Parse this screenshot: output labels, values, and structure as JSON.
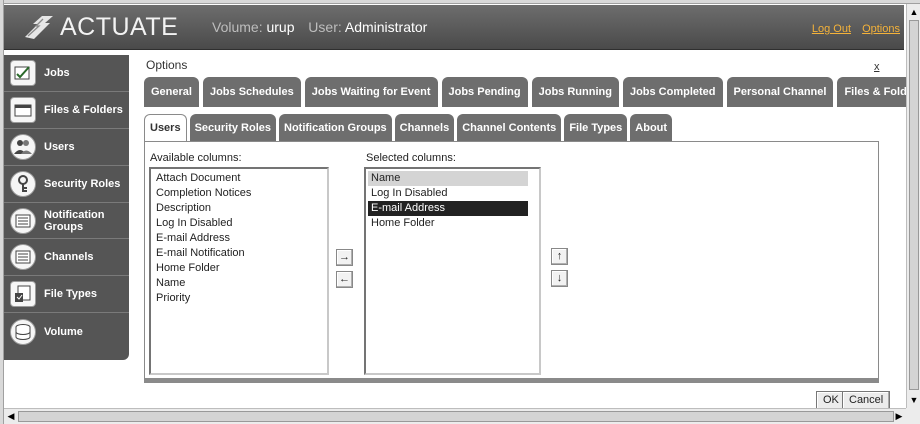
{
  "banner": {
    "logo_text": "ACTUATE",
    "volume_label": "Volume:",
    "volume_value": "urup",
    "user_label": "User:",
    "user_value": "Administrator",
    "logout": "Log Out",
    "options": "Options"
  },
  "nav": {
    "items": [
      {
        "label": "Jobs",
        "icon": "jobs-icon"
      },
      {
        "label": "Files & Folders",
        "icon": "folder-icon"
      },
      {
        "label": "Users",
        "icon": "users-icon"
      },
      {
        "label": "Security Roles",
        "icon": "key-icon"
      },
      {
        "label": "Notification Groups",
        "icon": "notification-icon"
      },
      {
        "label": "Channels",
        "icon": "channel-icon"
      },
      {
        "label": "File Types",
        "icon": "file-types-icon"
      },
      {
        "label": "Volume",
        "icon": "volume-icon"
      }
    ]
  },
  "options": {
    "title": "Options",
    "close": "x"
  },
  "tabs_row1": [
    "General",
    "Jobs Schedules",
    "Jobs Waiting for Event",
    "Jobs Pending",
    "Jobs Running",
    "Jobs Completed",
    "Personal Channel",
    "Files & Folders"
  ],
  "tabs_row2": [
    "Users",
    "Security Roles",
    "Notification Groups",
    "Channels",
    "Channel Contents",
    "File Types",
    "About"
  ],
  "active_tab": "Users",
  "columns": {
    "available_label": "Available columns:",
    "selected_label": "Selected columns:",
    "available": [
      "Attach Document",
      "Completion Notices",
      "Description",
      "Log In Disabled",
      "E-mail Address",
      "E-mail Notification",
      "Home Folder",
      "Name",
      "Priority"
    ],
    "selected": [
      "Name",
      "Log In Disabled",
      "E-mail Address",
      "Home Folder"
    ],
    "selected_highlight": "E-mail Address"
  },
  "arrows": {
    "add": "→",
    "remove": "←",
    "up": "↑",
    "down": "↓"
  },
  "buttons": {
    "ok": "OK",
    "cancel": "Cancel"
  }
}
